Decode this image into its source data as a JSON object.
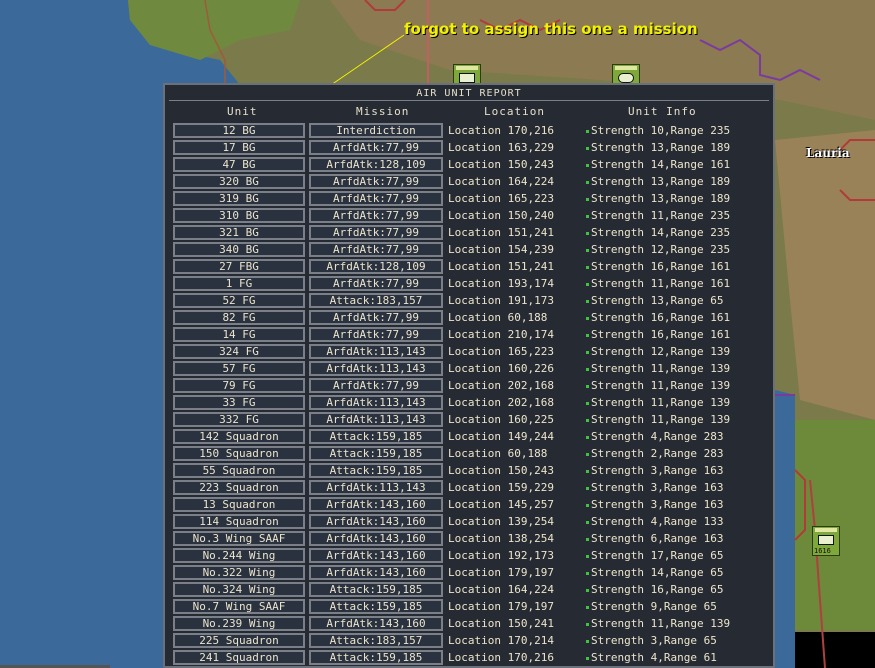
{
  "annotation": "forgot to assign this one a mission",
  "map_label": "Lauria",
  "counters": [
    {
      "label": "1616"
    }
  ],
  "report": {
    "title": "AIR UNIT REPORT",
    "headers": {
      "unit": "Unit",
      "mission": "Mission",
      "location": "Location",
      "info": "Unit Info"
    },
    "rows": [
      {
        "unit": "12 BG",
        "mission": "Interdiction",
        "location": "Location 170,216",
        "info": "Strength 10,Range 235"
      },
      {
        "unit": "17 BG",
        "mission": "ArfdAtk:77,99",
        "location": "Location 163,229",
        "info": "Strength 13,Range 189"
      },
      {
        "unit": "47 BG",
        "mission": "ArfdAtk:128,109",
        "location": "Location 150,243",
        "info": "Strength 14,Range 161"
      },
      {
        "unit": "320 BG",
        "mission": "ArfdAtk:77,99",
        "location": "Location 164,224",
        "info": "Strength 13,Range 189"
      },
      {
        "unit": "319 BG",
        "mission": "ArfdAtk:77,99",
        "location": "Location 165,223",
        "info": "Strength 13,Range 189"
      },
      {
        "unit": "310 BG",
        "mission": "ArfdAtk:77,99",
        "location": "Location 150,240",
        "info": "Strength 11,Range 235"
      },
      {
        "unit": "321 BG",
        "mission": "ArfdAtk:77,99",
        "location": "Location 151,241",
        "info": "Strength 14,Range 235"
      },
      {
        "unit": "340 BG",
        "mission": "ArfdAtk:77,99",
        "location": "Location 154,239",
        "info": "Strength 12,Range 235"
      },
      {
        "unit": "27 FBG",
        "mission": "ArfdAtk:128,109",
        "location": "Location 151,241",
        "info": "Strength 16,Range 161"
      },
      {
        "unit": "1 FG",
        "mission": "ArfdAtk:77,99",
        "location": "Location 193,174",
        "info": "Strength 11,Range 161"
      },
      {
        "unit": "52 FG",
        "mission": "Attack:183,157",
        "location": "Location 191,173",
        "info": "Strength 13,Range 65"
      },
      {
        "unit": "82 FG",
        "mission": "ArfdAtk:77,99",
        "location": "Location 60,188",
        "info": "Strength 16,Range 161"
      },
      {
        "unit": "14 FG",
        "mission": "ArfdAtk:77,99",
        "location": "Location 210,174",
        "info": "Strength 16,Range 161"
      },
      {
        "unit": "324 FG",
        "mission": "ArfdAtk:113,143",
        "location": "Location 165,223",
        "info": "Strength 12,Range 139"
      },
      {
        "unit": "57 FG",
        "mission": "ArfdAtk:113,143",
        "location": "Location 160,226",
        "info": "Strength 11,Range 139"
      },
      {
        "unit": "79 FG",
        "mission": "ArfdAtk:77,99",
        "location": "Location 202,168",
        "info": "Strength 11,Range 139"
      },
      {
        "unit": "33 FG",
        "mission": "ArfdAtk:113,143",
        "location": "Location 202,168",
        "info": "Strength 11,Range 139"
      },
      {
        "unit": "332 FG",
        "mission": "ArfdAtk:113,143",
        "location": "Location 160,225",
        "info": "Strength 11,Range 139"
      },
      {
        "unit": "142 Squadron",
        "mission": "Attack:159,185",
        "location": "Location 149,244",
        "info": "Strength 4,Range 283"
      },
      {
        "unit": "150 Squadron",
        "mission": "Attack:159,185",
        "location": "Location 60,188",
        "info": "Strength 2,Range 283"
      },
      {
        "unit": "55 Squadron",
        "mission": "Attack:159,185",
        "location": "Location 150,243",
        "info": "Strength 3,Range 163"
      },
      {
        "unit": "223 Squadron",
        "mission": "ArfdAtk:113,143",
        "location": "Location 159,229",
        "info": "Strength 3,Range 163"
      },
      {
        "unit": "13 Squadron",
        "mission": "ArfdAtk:143,160",
        "location": "Location 145,257",
        "info": "Strength 3,Range 163"
      },
      {
        "unit": "114 Squadron",
        "mission": "ArfdAtk:143,160",
        "location": "Location 139,254",
        "info": "Strength 4,Range 133"
      },
      {
        "unit": "No.3 Wing SAAF",
        "mission": "ArfdAtk:143,160",
        "location": "Location 138,254",
        "info": "Strength 6,Range 163"
      },
      {
        "unit": "No.244 Wing",
        "mission": "ArfdAtk:143,160",
        "location": "Location 192,173",
        "info": "Strength 17,Range 65"
      },
      {
        "unit": "No.322 Wing",
        "mission": "ArfdAtk:143,160",
        "location": "Location 179,197",
        "info": "Strength 14,Range 65"
      },
      {
        "unit": "No.324 Wing",
        "mission": "Attack:159,185",
        "location": "Location 164,224",
        "info": "Strength 16,Range 65"
      },
      {
        "unit": "No.7 Wing SAAF",
        "mission": "Attack:159,185",
        "location": "Location 179,197",
        "info": "Strength 9,Range 65"
      },
      {
        "unit": "No.239 Wing",
        "mission": "ArfdAtk:143,160",
        "location": "Location 150,241",
        "info": "Strength 11,Range 139"
      },
      {
        "unit": "225 Squadron",
        "mission": "Attack:183,157",
        "location": "Location 170,214",
        "info": "Strength 3,Range 65"
      },
      {
        "unit": "241 Squadron",
        "mission": "Attack:159,185",
        "location": "Location 170,216",
        "info": "Strength 4,Range 61"
      }
    ]
  }
}
